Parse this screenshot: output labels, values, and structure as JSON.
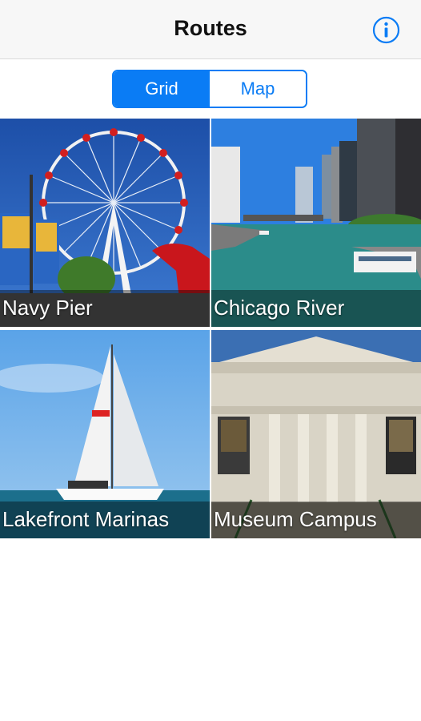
{
  "header": {
    "title": "Routes",
    "info_icon": "info-circle-icon"
  },
  "view_toggle": {
    "options": [
      "Grid",
      "Map"
    ],
    "selected": "Grid"
  },
  "routes": [
    {
      "label": "Navy Pier",
      "image": "ferris-wheel-photo"
    },
    {
      "label": "Chicago River",
      "image": "chicago-river-photo"
    },
    {
      "label": "Lakefront Marinas",
      "image": "sailboat-photo"
    },
    {
      "label": "Museum Campus",
      "image": "field-museum-photo"
    }
  ],
  "colors": {
    "accent": "#0a7cf5",
    "navbar_bg": "#f7f7f7"
  }
}
